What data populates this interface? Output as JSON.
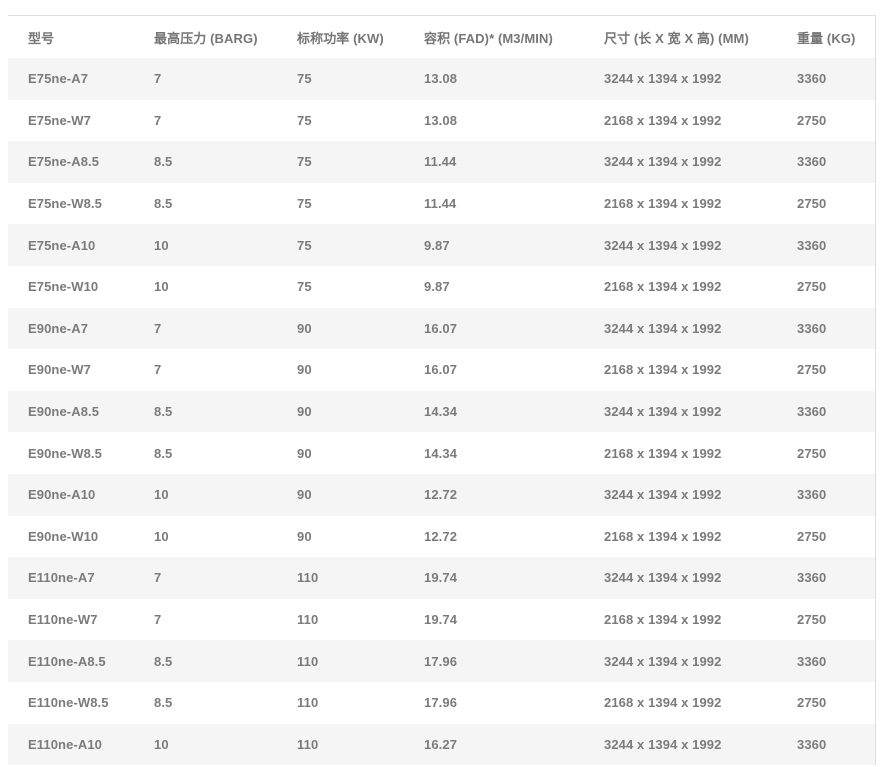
{
  "table": {
    "headers": [
      "型号",
      "最高压力 (BARG)",
      "标称功率 (KW)",
      "容积 (FAD)* (M3/MIN)",
      "尺寸 (长 X 宽 X 高) (MM)",
      "重量 (KG)"
    ],
    "rows": [
      [
        "E75ne-A7",
        "7",
        "75",
        "13.08",
        "3244 x 1394 x 1992",
        "3360"
      ],
      [
        "E75ne-W7",
        "7",
        "75",
        "13.08",
        "2168 x 1394 x 1992",
        "2750"
      ],
      [
        "E75ne-A8.5",
        "8.5",
        "75",
        "11.44",
        "3244 x 1394 x 1992",
        "3360"
      ],
      [
        "E75ne-W8.5",
        "8.5",
        "75",
        "11.44",
        "2168 x 1394 x 1992",
        "2750"
      ],
      [
        "E75ne-A10",
        "10",
        "75",
        "9.87",
        "3244 x 1394 x 1992",
        "3360"
      ],
      [
        "E75ne-W10",
        "10",
        "75",
        "9.87",
        "2168 x 1394 x 1992",
        "2750"
      ],
      [
        "E90ne-A7",
        "7",
        "90",
        "16.07",
        "3244 x 1394 x 1992",
        "3360"
      ],
      [
        "E90ne-W7",
        "7",
        "90",
        "16.07",
        "2168 x 1394 x 1992",
        "2750"
      ],
      [
        "E90ne-A8.5",
        "8.5",
        "90",
        "14.34",
        "3244 x 1394 x 1992",
        "3360"
      ],
      [
        "E90ne-W8.5",
        "8.5",
        "90",
        "14.34",
        "2168 x 1394 x 1992",
        "2750"
      ],
      [
        "E90ne-A10",
        "10",
        "90",
        "12.72",
        "3244 x 1394 x 1992",
        "3360"
      ],
      [
        "E90ne-W10",
        "10",
        "90",
        "12.72",
        "2168 x 1394 x 1992",
        "2750"
      ],
      [
        "E110ne-A7",
        "7",
        "110",
        "19.74",
        "3244 x 1394 x 1992",
        "3360"
      ],
      [
        "E110ne-W7",
        "7",
        "110",
        "19.74",
        "2168 x 1394 x 1992",
        "2750"
      ],
      [
        "E110ne-A8.5",
        "8.5",
        "110",
        "17.96",
        "3244 x 1394 x 1992",
        "3360"
      ],
      [
        "E110ne-W8.5",
        "8.5",
        "110",
        "17.96",
        "2168 x 1394 x 1992",
        "2750"
      ],
      [
        "E110ne-A10",
        "10",
        "110",
        "16.27",
        "3244 x 1394 x 1992",
        "3360"
      ]
    ]
  },
  "colors": {
    "text": "#7b7b7b",
    "stripe": "#f5f5f5",
    "border": "#dedede",
    "background": "#ffffff"
  }
}
